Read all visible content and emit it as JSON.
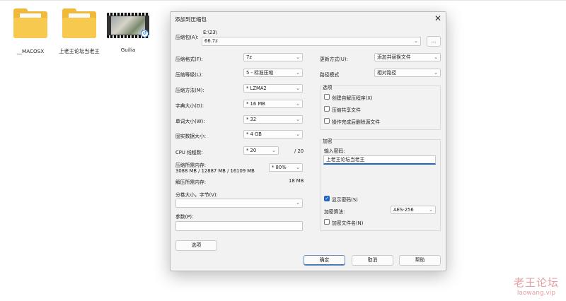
{
  "desktop": {
    "icons": [
      {
        "label": "__MACOSX",
        "type": "folder"
      },
      {
        "label": "上老王论坛当老王",
        "type": "folder"
      },
      {
        "label": "Guilia",
        "type": "video"
      }
    ]
  },
  "dialog": {
    "title": "添加到压缩包",
    "archive_label": "压缩包(A):",
    "archive_path": "E:\\23\\",
    "archive_name": "66.7z",
    "browse_label": "...",
    "left": {
      "format_label": "压缩格式(F):",
      "format_value": "7z",
      "level_label": "压缩等级(L):",
      "level_value": "5 - 标准压缩",
      "method_label": "压缩方法(M):",
      "method_value": "* LZMA2",
      "dict_label": "字典大小(D):",
      "dict_value": "* 16 MB",
      "word_label": "单词大小(W):",
      "word_value": "* 32",
      "solid_label": "固实数据大小:",
      "solid_value": "* 4 GB",
      "cpu_label": "CPU 线程数:",
      "cpu_value": "* 20",
      "cpu_total": "/ 20",
      "mem_label": "压缩所需内存:",
      "mem_detail": "3088 MB / 12887 MB / 16109 MB",
      "mem_value": "* 80%",
      "decomp_label": "解压所需内存:",
      "decomp_value": "18 MB",
      "split_label": "分卷大小，字节(V):",
      "split_value": "",
      "params_label": "参数(P):",
      "params_value": "",
      "options_button": "选项"
    },
    "right": {
      "update_label": "更新方式(U):",
      "update_value": "添加并替换文件",
      "path_label": "路径模式",
      "path_value": "相对路径",
      "options_group": "选项",
      "opt_sfx": "创建自解压程序(X)",
      "opt_shared": "压缩共享文件",
      "opt_delete": "操作完成后删除源文件",
      "encrypt_group": "加密",
      "pwd_label": "输入密码:",
      "pwd_value": "上老王论坛当老王",
      "show_pwd": "显示密码(S)",
      "enc_method_label": "加密算法:",
      "enc_method_value": "AES-256",
      "enc_names": "加密文件名(N)"
    },
    "buttons": {
      "ok": "确定",
      "cancel": "取消",
      "help": "帮助"
    }
  },
  "watermark": {
    "line1": "老王论坛",
    "line2": "laowang.vip"
  }
}
